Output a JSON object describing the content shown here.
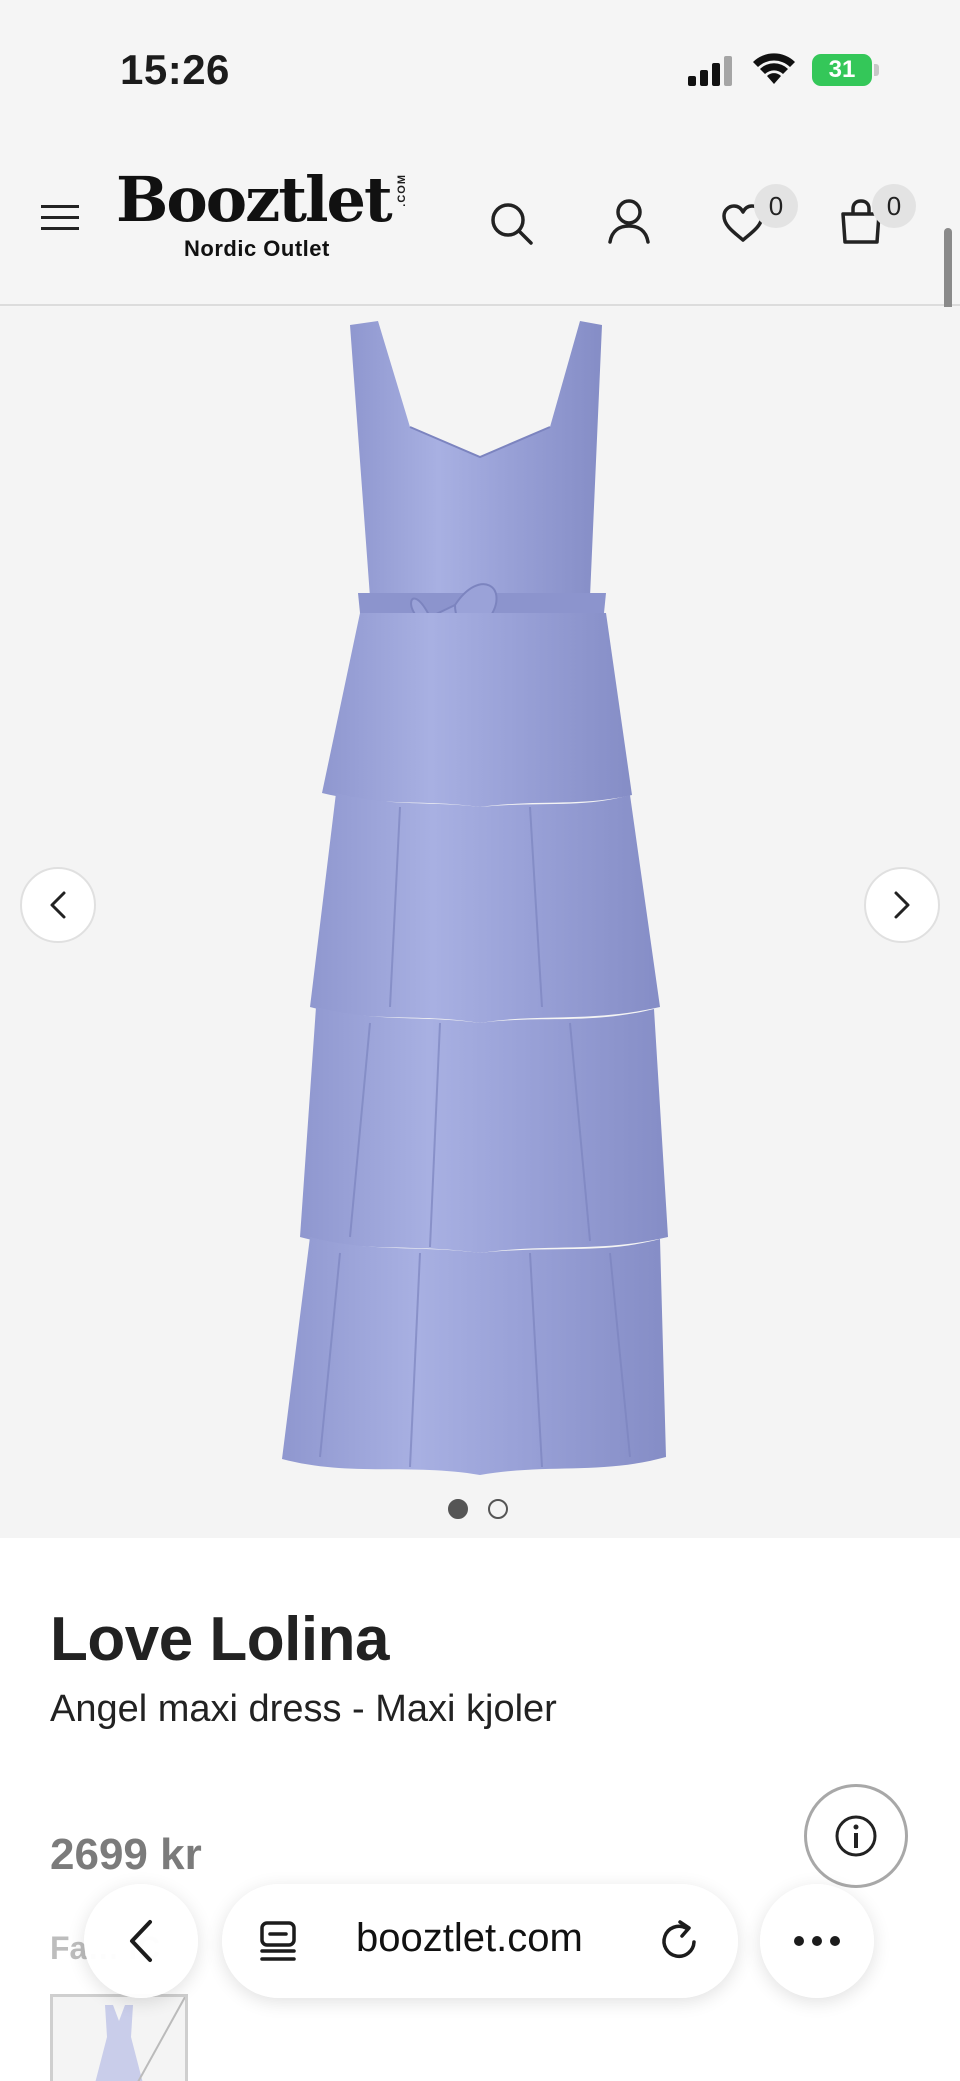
{
  "status_bar": {
    "time": "15:26",
    "battery": "31"
  },
  "header": {
    "logo_main": "Booztlet",
    "logo_com": ".COM",
    "logo_sub": "Nordic Outlet",
    "wishlist_count": "0",
    "cart_count": "0",
    "icons": [
      "menu-icon",
      "search-icon",
      "user-icon",
      "heart-icon",
      "bag-icon"
    ]
  },
  "gallery": {
    "image_count": 2,
    "active_index": 0,
    "dress_color": "#9fa7da"
  },
  "product": {
    "brand": "Love Lolina",
    "name": "Angel maxi dress - Maxi kjoler",
    "price": "2699 kr",
    "color_label": "Fa… IC"
  },
  "browser": {
    "url": "booztlet.com"
  },
  "colors": {
    "background": "#f5f5f5",
    "battery": "#34c759",
    "text": "#1c1c1c",
    "price": "#7b7b7b"
  }
}
